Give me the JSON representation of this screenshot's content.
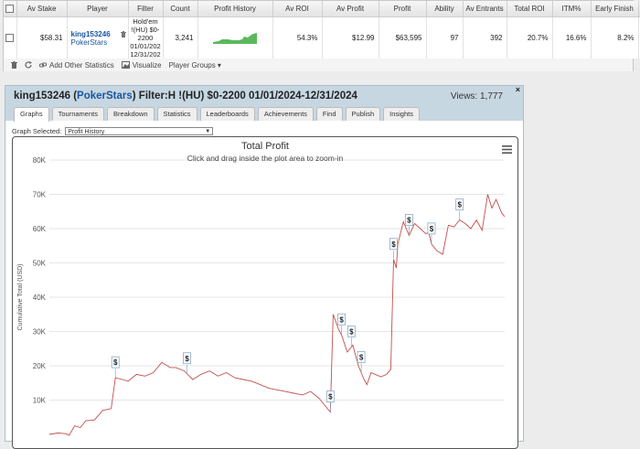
{
  "stats_table": {
    "headers": [
      "Av Stake",
      "Player",
      "Filter",
      "Count",
      "Profit History",
      "Av ROI",
      "Av Profit",
      "Profit",
      "Ability",
      "Av Entrants",
      "Total ROI",
      "ITM%",
      "Early Finish"
    ],
    "row": {
      "av_stake": "$58.31",
      "player_name": "king153246",
      "site": "PokerStars",
      "filter_lines": [
        "Hold'em",
        "!(HU) $0-",
        "2200",
        "01/01/202",
        "12/31/202"
      ],
      "count": "3,241",
      "av_roi": "54.3%",
      "av_profit": "$12.99",
      "profit": "$63,595",
      "ability": "97",
      "av_entrants": "392",
      "total_roi": "20.7%",
      "itm": "16.6%",
      "early_finish": "8.2%",
      "remove": "x"
    }
  },
  "toolbar": {
    "add_stats": "Add Other Statistics",
    "visualize": "Visualize",
    "player_groups": "Player Groups ▾"
  },
  "modal": {
    "player": "king153246",
    "site": "PokerStars",
    "filter_text": ") Filter:H !(HU) $0-2200 01/01/2024-12/31/2024",
    "views": "Views: 1,777",
    "close": "×",
    "tabs": [
      "Graphs",
      "Tournaments",
      "Breakdown",
      "Statistics",
      "Leaderboards",
      "Achievements",
      "Find",
      "Publish",
      "Insights"
    ],
    "graph_selected_label": "Graph Selected:",
    "graph_selected_value": "Profit History"
  },
  "chart_data": {
    "type": "line",
    "title": "Total Profit",
    "subtitle": "Click and drag inside the plot area to zoom-in",
    "ylabel": "Cumulative Total (USD)",
    "yticks": [
      "10K",
      "20K",
      "30K",
      "40K",
      "50K",
      "60K",
      "70K",
      "80K"
    ],
    "ylim": [
      0,
      80000
    ],
    "xlim": [
      0,
      3241
    ],
    "line_color": "#c0504d",
    "grid": true,
    "marker_label": "$",
    "series": [
      {
        "x": [
          0,
          60,
          120,
          140,
          180,
          220,
          260,
          320,
          380,
          440,
          470,
          520,
          560,
          620,
          680,
          740,
          800,
          860,
          900,
          960,
          1020,
          1080,
          1140,
          1200,
          1260,
          1320,
          1380,
          1440,
          1500,
          1560,
          1620,
          1680,
          1740,
          1800,
          1860,
          1920,
          1960,
          2000,
          2020,
          2060,
          2080,
          2120,
          2160,
          2200,
          2240,
          2260,
          2290,
          2320,
          2360,
          2400,
          2430,
          2450,
          2470,
          2480,
          2520,
          2560,
          2600,
          2640,
          2680,
          2700,
          2720,
          2760,
          2800,
          2840,
          2880,
          2920,
          2960,
          3000,
          3040,
          3080,
          3120,
          3150,
          3180,
          3220,
          3241
        ],
        "y": [
          0,
          400,
          200,
          -300,
          2500,
          2000,
          4000,
          4200,
          7000,
          7500,
          16500,
          16000,
          15500,
          17500,
          17000,
          18000,
          21000,
          19500,
          19500,
          18500,
          16000,
          17500,
          18500,
          17000,
          18000,
          16500,
          16000,
          15500,
          14500,
          13500,
          13000,
          12500,
          12000,
          11500,
          12500,
          10500,
          8500,
          6500,
          35000,
          30500,
          29000,
          24000,
          26000,
          20000,
          16000,
          14500,
          18000,
          17500,
          16800,
          17500,
          19000,
          51000,
          48500,
          55500,
          62000,
          58000,
          61500,
          60000,
          58500,
          59000,
          55500,
          53500,
          52500,
          61000,
          60500,
          62500,
          61500,
          60000,
          62500,
          59500,
          70000,
          66000,
          68500,
          64500,
          63500
        ]
      }
    ],
    "markers_x": [
      470,
      980,
      2000,
      2080,
      2150,
      2220,
      2450,
      2560,
      2720,
      2920
    ]
  }
}
